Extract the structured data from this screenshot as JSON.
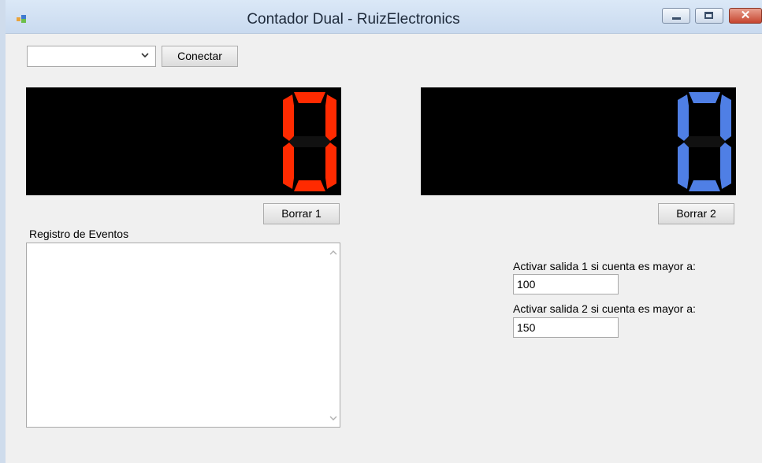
{
  "window": {
    "title": "Contador Dual - RuizElectronics",
    "minimize_icon": "minimize-icon",
    "maximize_icon": "maximize-icon",
    "close_icon": "close-icon",
    "close_glyph": "✕"
  },
  "connection": {
    "port_selected": "",
    "connect_label": "Conectar",
    "dropdown_icon": "chevron-down-icon"
  },
  "counter1": {
    "value": "0",
    "color": "#ff2a00",
    "clear_label": "Borrar 1"
  },
  "counter2": {
    "value": "0",
    "color": "#4f7fe5",
    "clear_label": "Borrar 2"
  },
  "log": {
    "label": "Registro de Eventos",
    "content": ""
  },
  "outputs": {
    "s1_label": "Activar salida 1 si cuenta es mayor a:",
    "s1_value": "100",
    "s2_label": "Activar salida 2 si cuenta es mayor a:",
    "s2_value": "150"
  }
}
